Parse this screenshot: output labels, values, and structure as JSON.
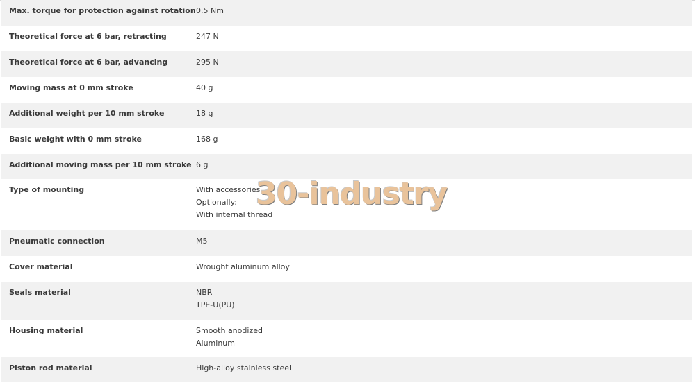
{
  "specs": [
    {
      "label": "Max. torque for protection against rotation",
      "values": [
        "0.5 Nm"
      ]
    },
    {
      "label": "Theoretical force at 6 bar, retracting",
      "values": [
        "247 N"
      ]
    },
    {
      "label": "Theoretical force at 6 bar, advancing",
      "values": [
        "295 N"
      ]
    },
    {
      "label": "Moving mass at 0 mm stroke",
      "values": [
        "40 g"
      ]
    },
    {
      "label": "Additional weight per 10 mm stroke",
      "values": [
        "18 g"
      ]
    },
    {
      "label": "Basic weight with 0 mm stroke",
      "values": [
        "168 g"
      ]
    },
    {
      "label": "Additional moving mass per 10 mm stroke",
      "values": [
        "6 g"
      ]
    },
    {
      "label": "Type of mounting",
      "values": [
        "With accessories",
        "Optionally:",
        "With internal thread"
      ]
    },
    {
      "label": "Pneumatic connection",
      "values": [
        "M5"
      ]
    },
    {
      "label": "Cover material",
      "values": [
        "Wrought aluminum alloy"
      ]
    },
    {
      "label": "Seals material",
      "values": [
        "NBR",
        "TPE-U(PU)"
      ]
    },
    {
      "label": "Housing material",
      "values": [
        "Smooth anodized",
        "Aluminum"
      ]
    },
    {
      "label": "Piston rod material",
      "values": [
        "High-alloy stainless steel"
      ]
    }
  ],
  "watermark": {
    "text": "30-industry"
  },
  "colors": {
    "row_alt": "#f1f1f1",
    "row_plain": "#ffffff",
    "text": "#3a3a3a",
    "watermark": "#e6b98a"
  }
}
